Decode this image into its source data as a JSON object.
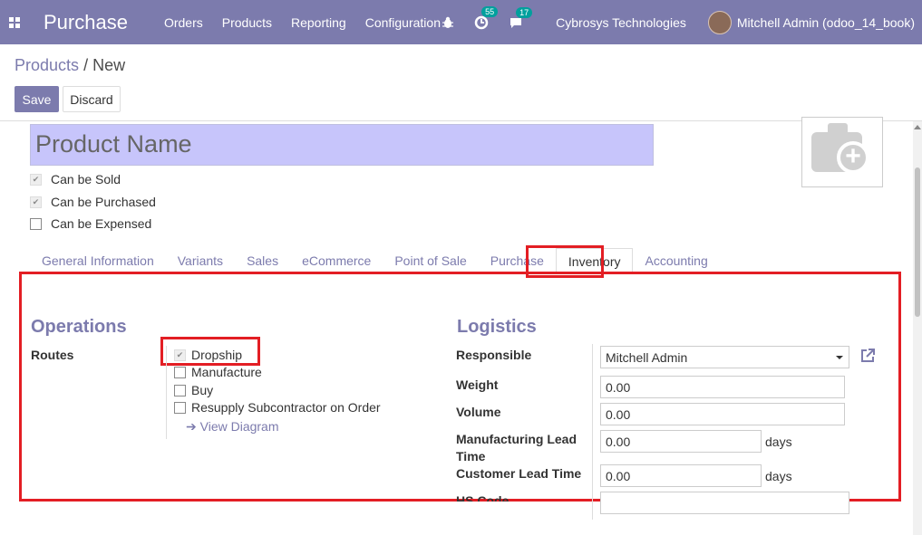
{
  "navbar": {
    "app_title": "Purchase",
    "menu": [
      "Orders",
      "Products",
      "Reporting",
      "Configuration"
    ],
    "activity_count": "55",
    "message_count": "17",
    "company": "Cybrosys Technologies",
    "user": "Mitchell Admin (odoo_14_book)"
  },
  "breadcrumb": {
    "parent": "Products",
    "separator": "/",
    "current": "New"
  },
  "buttons": {
    "save": "Save",
    "discard": "Discard"
  },
  "product": {
    "name_placeholder": "Product Name",
    "can_be_sold": {
      "label": "Can be Sold",
      "checked": true
    },
    "can_be_purchased": {
      "label": "Can be Purchased",
      "checked": true
    },
    "can_be_expensed": {
      "label": "Can be Expensed",
      "checked": false
    }
  },
  "tabs": [
    {
      "label": "General Information",
      "active": false
    },
    {
      "label": "Variants",
      "active": false
    },
    {
      "label": "Sales",
      "active": false
    },
    {
      "label": "eCommerce",
      "active": false
    },
    {
      "label": "Point of Sale",
      "active": false
    },
    {
      "label": "Purchase",
      "active": false
    },
    {
      "label": "Inventory",
      "active": true
    },
    {
      "label": "Accounting",
      "active": false
    }
  ],
  "operations": {
    "title": "Operations",
    "routes_label": "Routes",
    "routes": [
      {
        "label": "Dropship",
        "checked": true
      },
      {
        "label": "Manufacture",
        "checked": false
      },
      {
        "label": "Buy",
        "checked": false
      },
      {
        "label": "Resupply Subcontractor on Order",
        "checked": false
      }
    ],
    "view_diagram": "View Diagram"
  },
  "logistics": {
    "title": "Logistics",
    "responsible_label": "Responsible",
    "responsible_value": "Mitchell Admin",
    "weight_label": "Weight",
    "weight_value": "0.00",
    "volume_label": "Volume",
    "volume_value": "0.00",
    "mfg_lead_label_1": "Manufacturing Lead",
    "mfg_lead_label_2": "Time",
    "mfg_lead_value": "0.00",
    "mfg_lead_unit": "days",
    "cust_lead_label": "Customer Lead Time",
    "cust_lead_value": "0.00",
    "cust_lead_unit": "days",
    "hs_code_label": "HS Code"
  },
  "colors": {
    "brand": "#7c7bad",
    "highlight": "#e31e24",
    "input_required": "#c7c5fb"
  }
}
